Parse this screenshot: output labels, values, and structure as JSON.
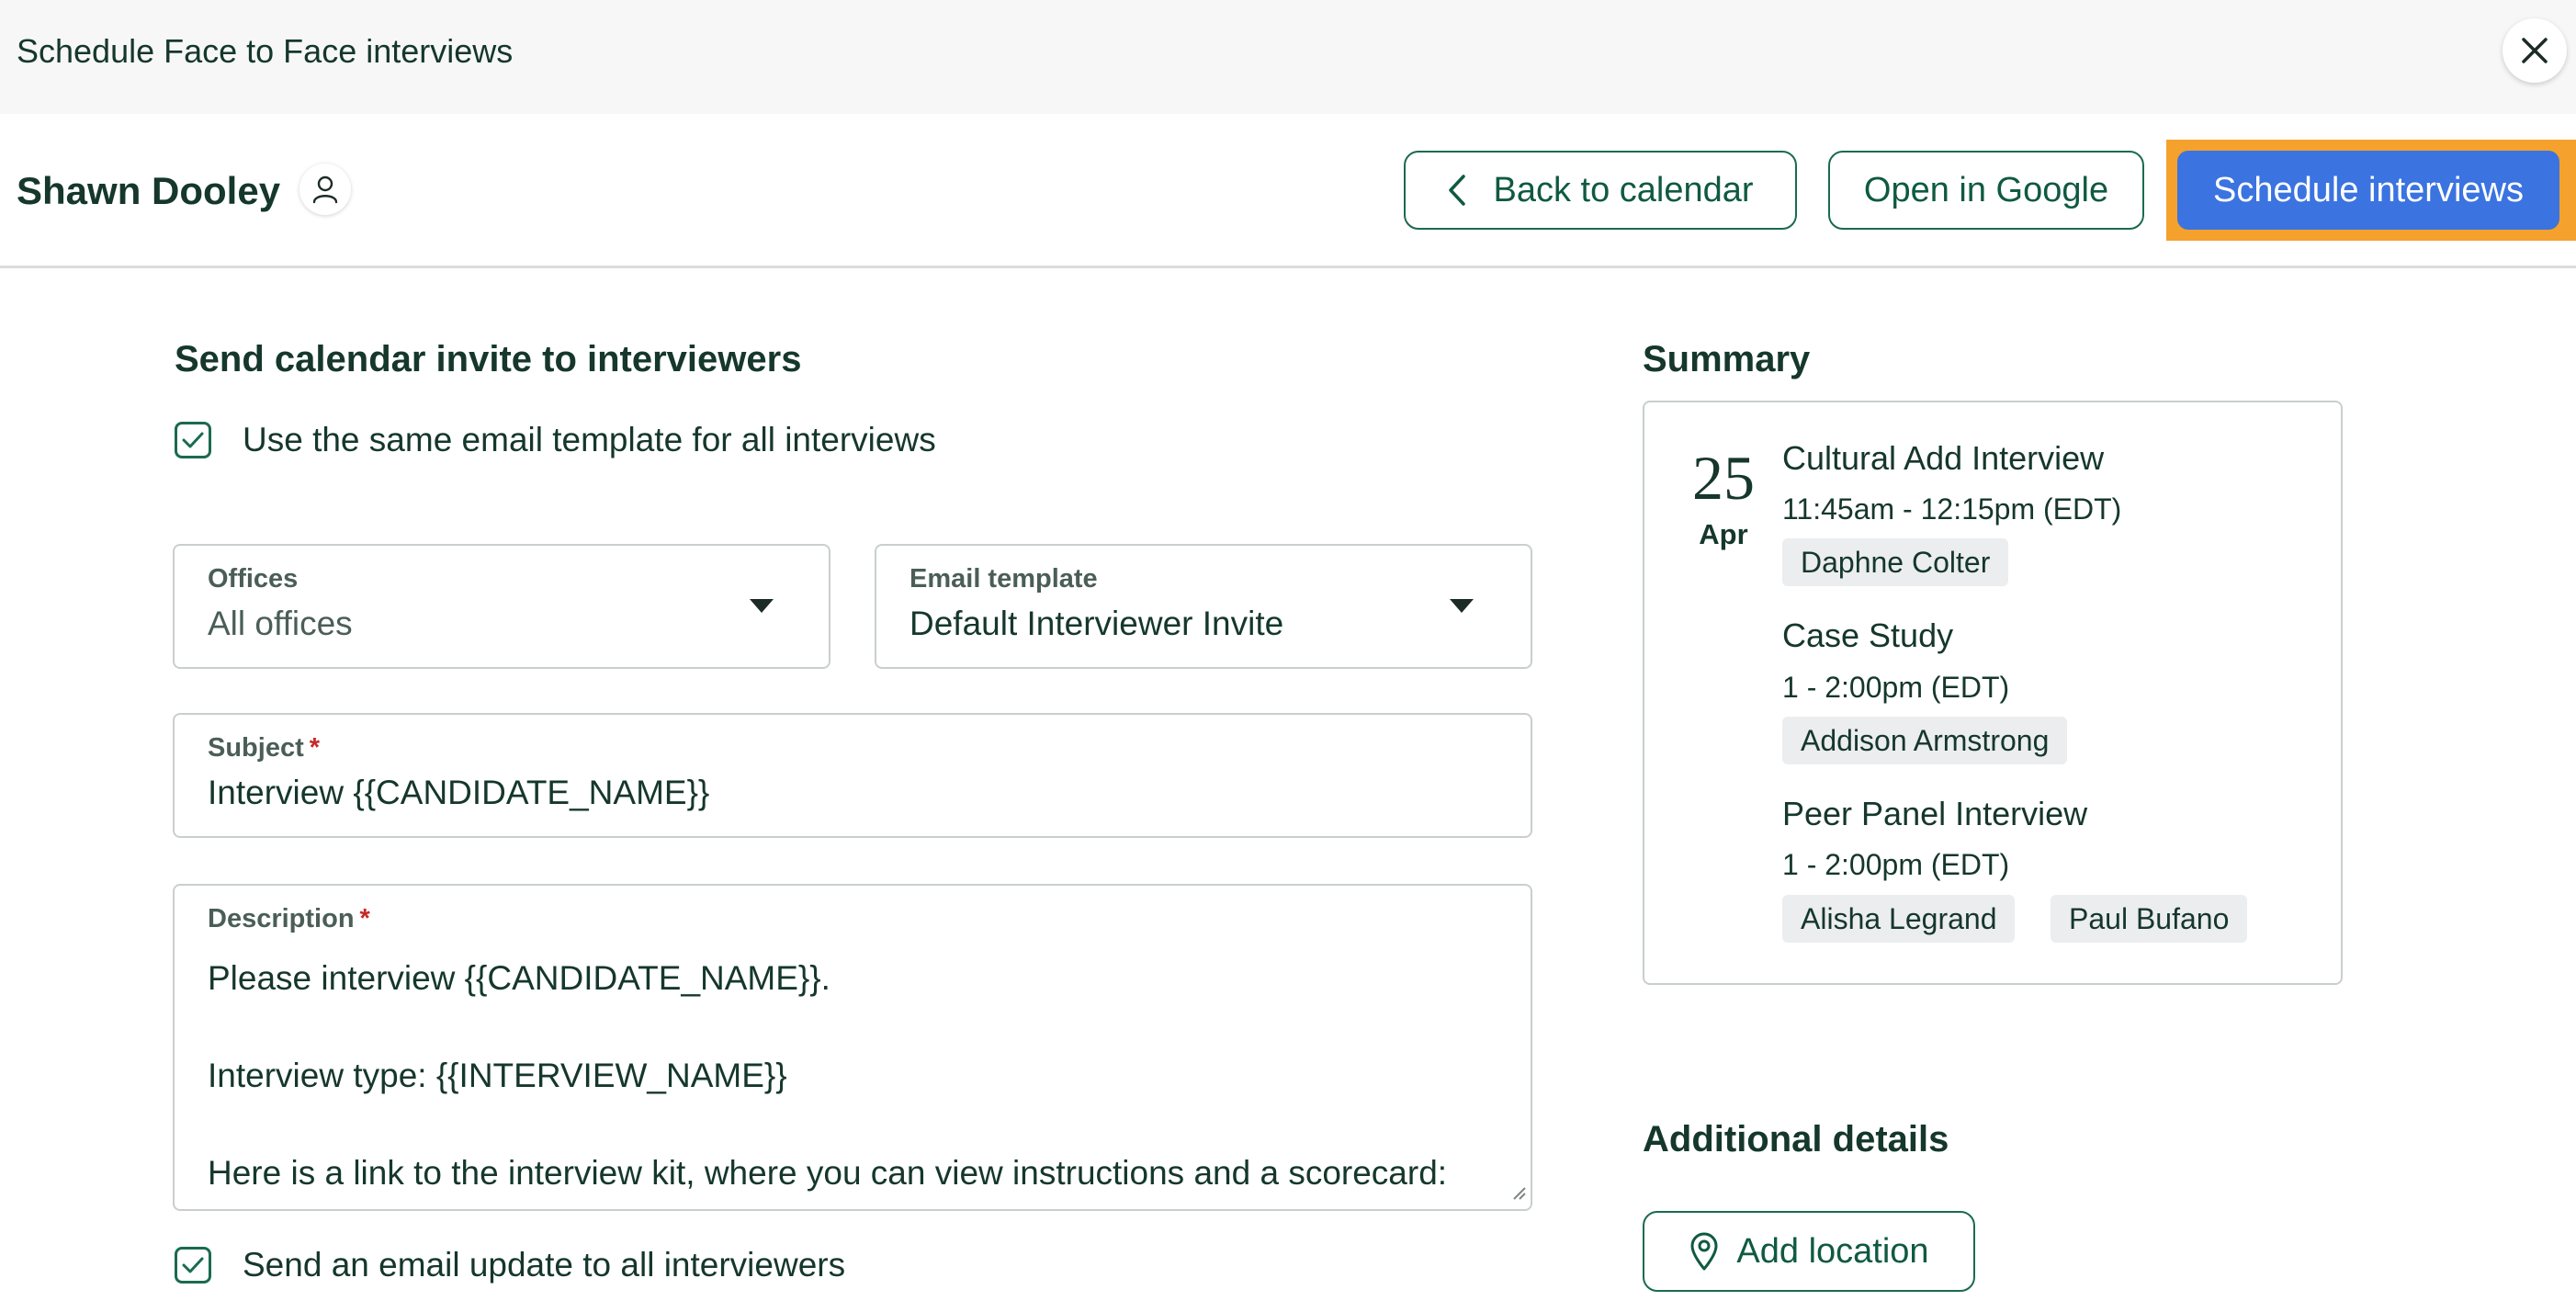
{
  "window": {
    "title": "Schedule Face to Face interviews"
  },
  "header": {
    "candidate_name": "Shawn Dooley",
    "back_label": "Back to calendar",
    "google_label": "Open in Google",
    "schedule_label": "Schedule interviews"
  },
  "invite": {
    "title": "Send calendar invite to interviewers",
    "same_template": {
      "label": "Use the same email template for all interviews",
      "checked": true
    },
    "offices": {
      "label": "Offices",
      "value": "All offices"
    },
    "email_template": {
      "label": "Email template",
      "value": "Default Interviewer Invite"
    },
    "subject": {
      "label": "Subject",
      "required_mark": "*",
      "value": "Interview {{CANDIDATE_NAME}}"
    },
    "description": {
      "label": "Description",
      "required_mark": "*",
      "value": "Please interview {{CANDIDATE_NAME}}.\n\nInterview type: {{INTERVIEW_NAME}}\n\nHere is a link to the interview kit, where you can view instructions and a scorecard:"
    },
    "send_update": {
      "label": "Send an email update to all interviewers",
      "checked": true
    }
  },
  "summary": {
    "title": "Summary",
    "date": {
      "day": "25",
      "month": "Apr"
    },
    "interviews": [
      {
        "name": "Cultural Add Interview",
        "time": "11:45am - 12:15pm (EDT)",
        "interviewers": [
          "Daphne Colter"
        ]
      },
      {
        "name": "Case Study",
        "time": "1 - 2:00pm (EDT)",
        "interviewers": [
          "Addison Armstrong"
        ]
      },
      {
        "name": "Peer Panel Interview",
        "time": "1 - 2:00pm (EDT)",
        "interviewers": [
          "Alisha Legrand",
          "Paul Bufano"
        ]
      }
    ]
  },
  "additional": {
    "title": "Additional details",
    "add_location_label": "Add location"
  },
  "icons": {
    "close": "close-icon",
    "person": "person-icon",
    "chevron_left": "chevron-left-icon",
    "caret_down": "caret-down-icon",
    "check": "checkmark-icon",
    "pin": "map-pin-icon"
  },
  "colors": {
    "primary_text": "#15372c",
    "brand_green": "#1a6b4e",
    "primary_button": "#3b73e0",
    "highlight": "#f5a12d",
    "required": "#c62828"
  }
}
